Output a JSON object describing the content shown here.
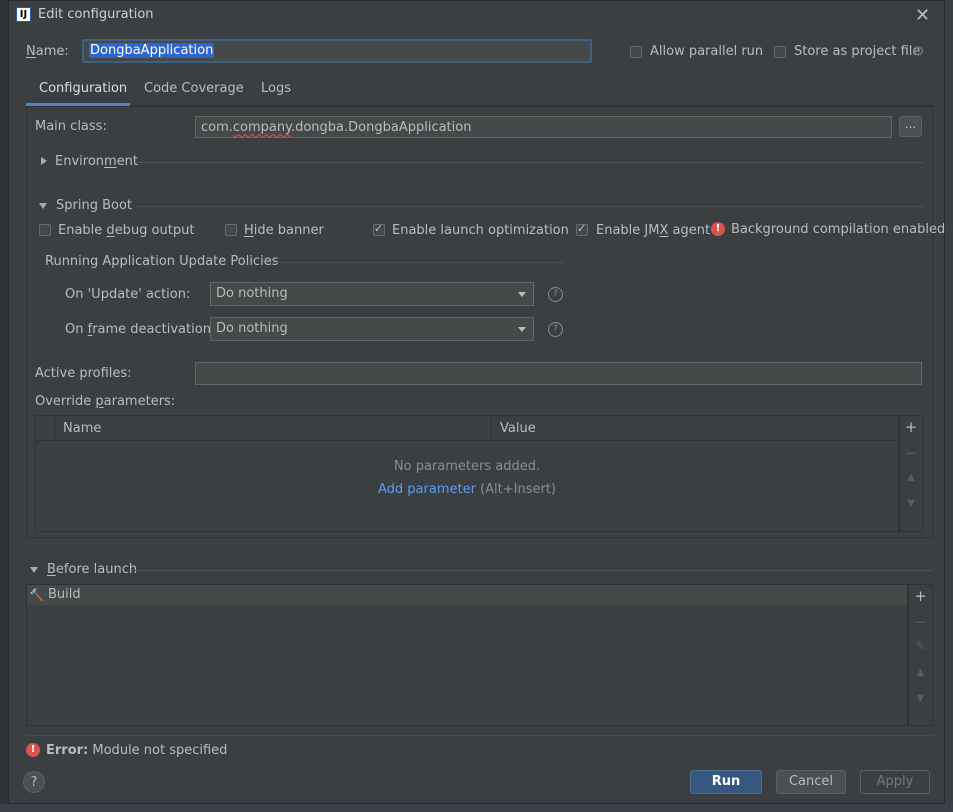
{
  "window": {
    "title": "Edit configuration"
  },
  "header": {
    "name_label": "Name:",
    "name_value": "DongbaApplication",
    "allow_parallel": {
      "label": "Allow parallel run",
      "checked": false
    },
    "store_project": {
      "label": "Store as project file",
      "checked": false
    }
  },
  "tabs": [
    {
      "label": "Configuration",
      "active": true
    },
    {
      "label": "Code Coverage",
      "active": false
    },
    {
      "label": "Logs",
      "active": false
    }
  ],
  "config": {
    "main_class_label": "Main class:",
    "main_class_pre": "com.",
    "main_class_squiggle": "company",
    "main_class_post": ".dongba.DongbaApplication",
    "browse_label": "...",
    "environment_label": "Environment",
    "spring_boot_label": "Spring Boot",
    "options": {
      "debug": {
        "label": "Enable debug output",
        "checked": false
      },
      "banner": {
        "label": "Hide banner",
        "checked": false
      },
      "launch_opt": {
        "label": "Enable launch optimization",
        "checked": true
      },
      "jmx": {
        "label": "Enable JMX agent",
        "checked": true
      }
    },
    "bg_compilation": "Background compilation enabled",
    "policies_title": "Running Application Update Policies",
    "on_update_label": "On 'Update' action:",
    "on_update_value": "Do nothing",
    "on_frame_label": "On frame deactivation:",
    "on_frame_value": "Do nothing",
    "active_profiles_label": "Active profiles:",
    "active_profiles_value": "",
    "override_label": "Override parameters:",
    "params": {
      "col_name": "Name",
      "col_value": "Value",
      "empty_text": "No parameters added.",
      "add_link": "Add parameter",
      "add_shortcut": "(Alt+Insert)"
    }
  },
  "before_launch": {
    "label": "Before launch",
    "items": [
      "Build"
    ]
  },
  "footer": {
    "error_label": "Error:",
    "error_text": "Module not specified",
    "run": "Run",
    "cancel": "Cancel",
    "apply": "Apply",
    "help": "?"
  },
  "colors": {
    "accent": "#4a88c7",
    "run_button": "#365880",
    "error": "#d9534f",
    "link": "#589df6"
  }
}
